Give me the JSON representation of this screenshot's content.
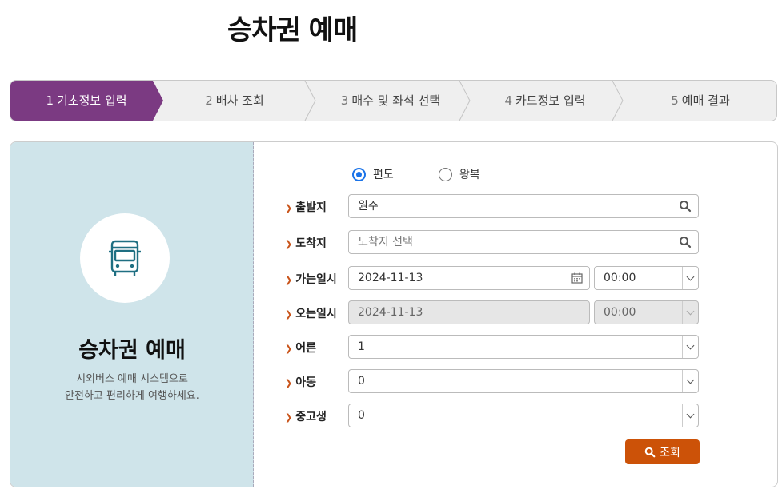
{
  "page": {
    "title": "승차권 예매"
  },
  "steps": [
    {
      "num": "1",
      "label": "기초정보 입력",
      "active": true
    },
    {
      "num": "2",
      "label": "배차 조회",
      "active": false
    },
    {
      "num": "3",
      "label": "매수 및 좌석 선택",
      "active": false
    },
    {
      "num": "4",
      "label": "카드정보 입력",
      "active": false
    },
    {
      "num": "5",
      "label": "예매 결과",
      "active": false
    }
  ],
  "colors": {
    "active_step": "#7b3a82",
    "accent": "#cc5208",
    "side_panel": "#cfe4ea"
  },
  "side": {
    "title": "승차권 예매",
    "desc_line1": "시외버스 예매 시스템으로",
    "desc_line2": "안전하고 편리하게 여행하세요.",
    "icon": "bus-icon"
  },
  "trip_type": {
    "oneway_label": "편도",
    "roundtrip_label": "왕복",
    "selected": "편도"
  },
  "form": {
    "departure": {
      "label": "출발지",
      "value": "원주"
    },
    "arrival": {
      "label": "도착지",
      "placeholder": "도착지 선택"
    },
    "go": {
      "label": "가는일시",
      "date": "2024-11-13",
      "time": "00:00"
    },
    "return": {
      "label": "오는일시",
      "date": "2024-11-13",
      "time": "00:00"
    },
    "adult": {
      "label": "어른",
      "value": "1"
    },
    "child": {
      "label": "아동",
      "value": "0"
    },
    "teen": {
      "label": "중고생",
      "value": "0"
    }
  },
  "search_button": {
    "label": "조회"
  }
}
